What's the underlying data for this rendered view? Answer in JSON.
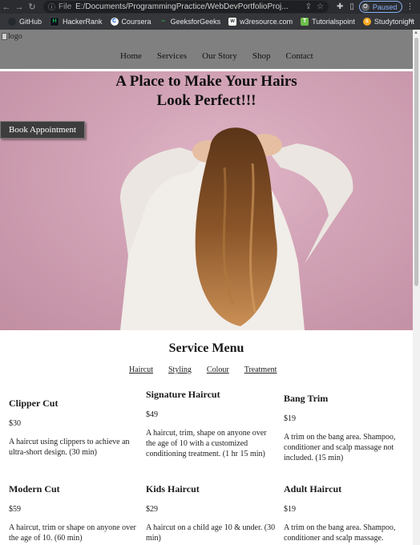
{
  "browser": {
    "url_prefix": "File",
    "url": "E:/Documents/ProgrammingPractice/WebDevPortfolioProj...",
    "paused_label": "Paused",
    "profile_initial": "O",
    "bookmarks": [
      {
        "label": "GitHub",
        "icon": "github-icon",
        "color": "#24292e"
      },
      {
        "label": "HackerRank",
        "icon": "hackerrank-icon",
        "color": "#1ba94c"
      },
      {
        "label": "Coursera",
        "icon": "coursera-icon",
        "color": "#0056d2"
      },
      {
        "label": "GeeksforGeeks",
        "icon": "gfg-icon",
        "color": "#2f8d46"
      },
      {
        "label": "w3resource.com",
        "icon": "w3resource-icon",
        "color": "#ffffff"
      },
      {
        "label": "Tutorialspoint",
        "icon": "tutorialspoint-icon",
        "color": "#6fbf4b"
      },
      {
        "label": "Studytonight",
        "icon": "studytonight-icon",
        "color": "#f6a821"
      }
    ],
    "more_bookmarks": "»"
  },
  "site": {
    "logo_alt": "logo",
    "nav": [
      "Home",
      "Services",
      "Our Story",
      "Shop",
      "Contact"
    ],
    "hero": {
      "title_line1": "A Place to Make Your Hairs",
      "title_line2": "Look Perfect!!!",
      "button": "Book Appointment"
    },
    "services": {
      "title": "Service Menu",
      "tabs": [
        "Haircut",
        "Styling",
        "Colour",
        "Treatment"
      ],
      "items": [
        {
          "name": "Clipper Cut",
          "price": "$30",
          "desc": "A haircut using clippers to achieve an ultra-short design. (30 min)"
        },
        {
          "name": "Signature Haircut",
          "price": "$49",
          "desc": "A haircut, trim, shape on anyone over the age of 10 with a customized conditioning treatment. (1 hr 15 min)"
        },
        {
          "name": "Bang Trim",
          "price": "$19",
          "desc": "A trim on the bang area. Shampoo, conditioner and scalp massage not included. (15 min)"
        },
        {
          "name": "Modern Cut",
          "price": "$59",
          "desc": "A haircut, trim or shape on anyone over the age of 10. (60 min)"
        },
        {
          "name": "Kids Haircut",
          "price": "$29",
          "desc": "A haircut on a child age 10 & under. (30 min)"
        },
        {
          "name": "Adult Haircut",
          "price": "$19",
          "desc": "A trim on the bang area. Shampoo, conditioner and scalp massage."
        }
      ]
    }
  },
  "colors": {
    "header_bg": "#808080",
    "hero_bg": "#d2a3b6",
    "button_bg": "#3d3d3d"
  }
}
